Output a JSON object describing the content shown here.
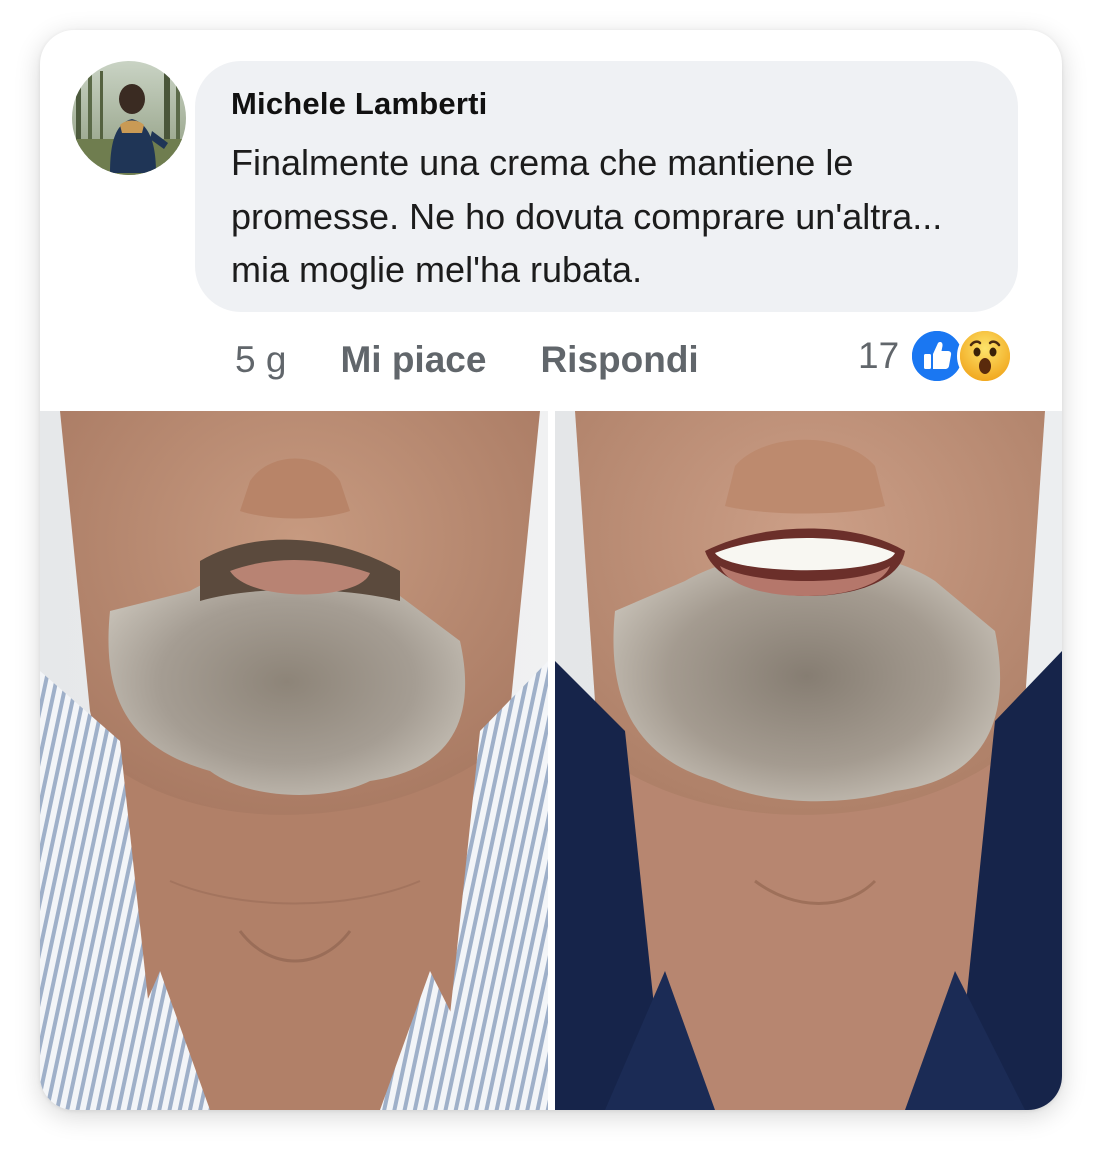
{
  "comment": {
    "author": "Michele Lamberti",
    "text": "Finalmente una crema che mantiene le promesse. Ne ho dovuta comprare un'altra... mia moglie mel'ha rubata.",
    "time": "5 g",
    "like_label": "Mi piace",
    "reply_label": "Rispondi",
    "reaction_count": "17",
    "reactions": [
      "like-icon",
      "wow-icon"
    ]
  },
  "colors": {
    "bubble": "#eff1f4",
    "meta_text": "#61666b",
    "like_blue": "#1a77f2",
    "wow_yellow": "#f7b928"
  }
}
